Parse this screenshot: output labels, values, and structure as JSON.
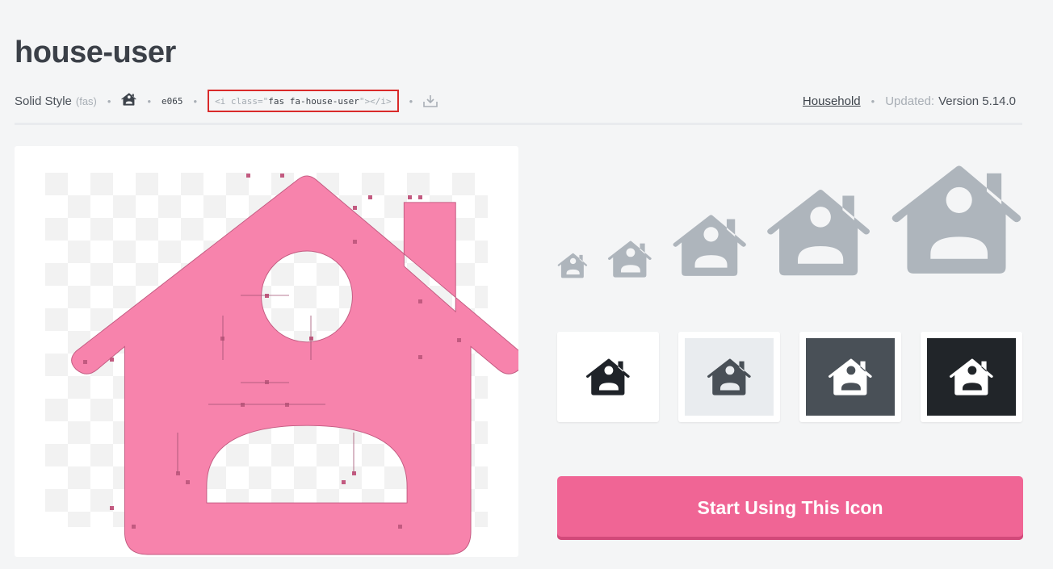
{
  "page": {
    "title": "house-user"
  },
  "meta": {
    "style_label": "Solid Style",
    "style_abbr": "(fas)",
    "icon_name": "house-user-icon",
    "unicode": "e065",
    "snippet_open": "<i class=\"",
    "snippet_class": "fas fa-house-user",
    "snippet_close": "\"></i>",
    "download_icon": "download-icon",
    "category": "Household",
    "updated_label": "Updated:",
    "version": "Version 5.14.0"
  },
  "preview": {
    "icon": "house-user-icon",
    "fill": "#f783ac"
  },
  "sizes": {
    "color": "#aeb5bc",
    "icon": "house-user-icon"
  },
  "swatches": [
    {
      "bg": "#ffffff",
      "fg": "#1f2329"
    },
    {
      "bg": "#e9ecef",
      "fg": "#495057"
    },
    {
      "bg": "#495057",
      "fg": "#ffffff"
    },
    {
      "bg": "#212529",
      "fg": "#ffffff"
    }
  ],
  "cta": {
    "label": "Start Using This Icon",
    "color": "#f06595"
  }
}
